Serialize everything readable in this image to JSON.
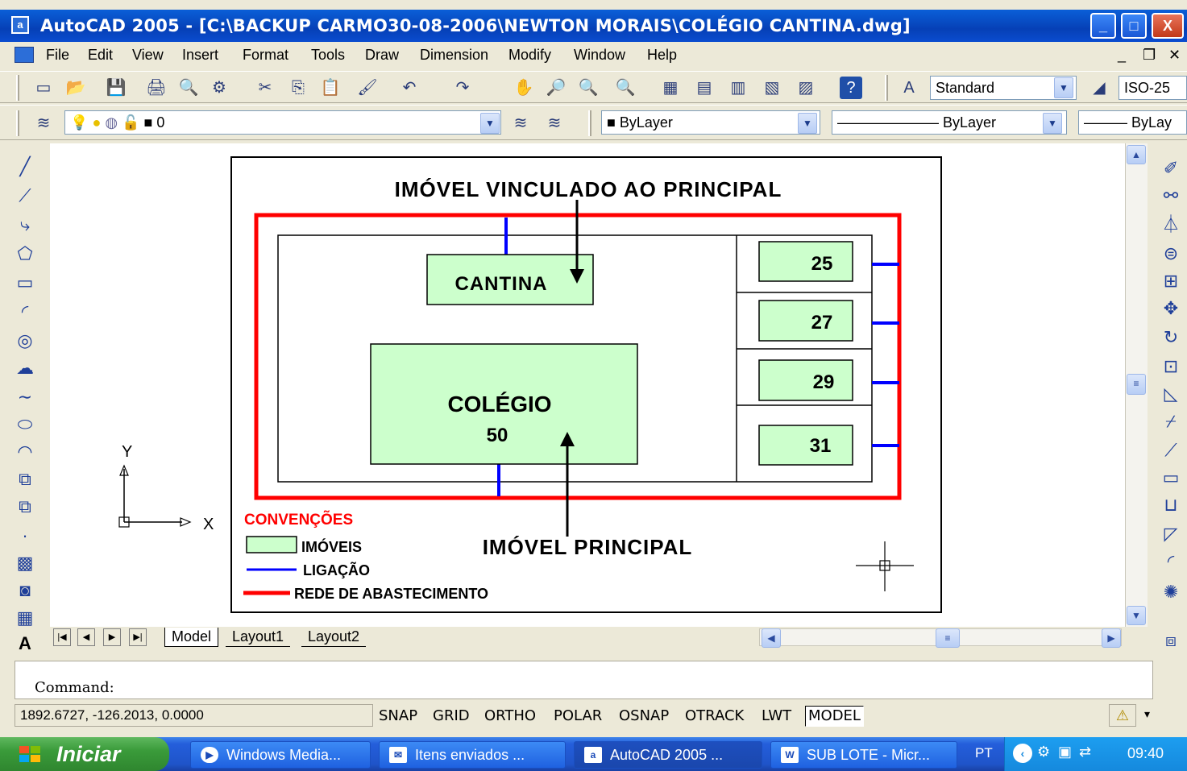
{
  "window": {
    "title": "AutoCAD 2005 - [C:\\BACKUP CARMO30-08-2006\\NEWTON MORAIS\\COLÉGIO CANTINA.dwg]",
    "controls": [
      "_",
      "□",
      "X"
    ]
  },
  "menu": [
    "File",
    "Edit",
    "View",
    "Insert",
    "Format",
    "Tools",
    "Draw",
    "Dimension",
    "Modify",
    "Window",
    "Help"
  ],
  "toolbar": {
    "text_style": "Standard",
    "dim_style": "ISO-25",
    "layer": "0",
    "color": "ByLayer",
    "linetype": "ByLayer",
    "lineweight": "ByLay"
  },
  "drawing": {
    "title_top": "IMÓVEL VINCULADO AO PRINCIPAL",
    "cantina": "CANTINA",
    "colegio": "COLÉGIO",
    "colegio_number": "50",
    "lots": [
      "25",
      "27",
      "29",
      "31"
    ],
    "title_bottom": "IMÓVEL PRINCIPAL",
    "legend_title": "CONVENÇÕES",
    "legend_items": [
      "IMÓVEIS",
      "LIGAÇÃO",
      "REDE DE ABASTECIMENTO"
    ],
    "ucs_y": "Y",
    "ucs_x": "X",
    "colors": {
      "red_network": "#ff0000",
      "blue_connection": "#0000ff",
      "lot_fill": "#ccffcc"
    }
  },
  "tabs": [
    "Model",
    "Layout1",
    "Layout2"
  ],
  "command": {
    "prompt": "Command:"
  },
  "status": {
    "coords": "1892.6727, -126.2013, 0.0000",
    "toggles": [
      "SNAP",
      "GRID",
      "ORTHO",
      "POLAR",
      "OSNAP",
      "OTRACK",
      "LWT",
      "MODEL"
    ]
  },
  "taskbar": {
    "start": "Iniciar",
    "tasks": [
      "Windows Media...",
      "Itens enviados ...",
      "AutoCAD 2005 ...",
      "SUB LOTE - Micr..."
    ],
    "lang": "PT",
    "clock": "09:40"
  }
}
